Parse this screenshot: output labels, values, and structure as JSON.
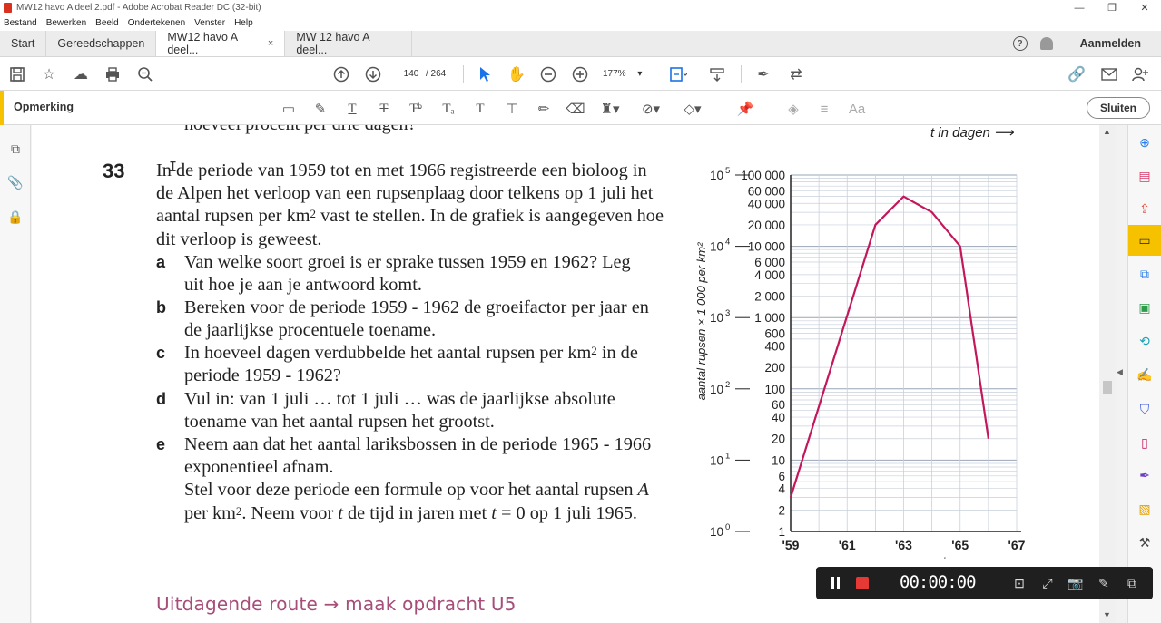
{
  "window": {
    "title": "MW12 havo A deel 2.pdf - Adobe Acrobat Reader DC (32-bit)",
    "minimize": "—",
    "maximize": "❐",
    "close": "✕"
  },
  "menu": [
    "Bestand",
    "Bewerken",
    "Beeld",
    "Ondertekenen",
    "Venster",
    "Help"
  ],
  "tabs": [
    {
      "label": "Start"
    },
    {
      "label": "Gereedschappen"
    },
    {
      "label": "MW12 havo A deel...",
      "close": "×"
    },
    {
      "label": "MW 12 havo A deel..."
    }
  ],
  "header_right": {
    "help": "?",
    "signin": "Aanmelden"
  },
  "toolbar": {
    "page_current": "140",
    "page_total": "/ 264",
    "zoom": "177%"
  },
  "comment_toolbar": {
    "label": "Opmerking",
    "close_label": "Sluiten"
  },
  "document": {
    "prev_line": "hoeveel procent per drie dagen?",
    "t_axis_label": "t in dagen ⟶",
    "question_number": "33",
    "question_text_1": "In de periode van 1959 tot en met 1966 registreerde een bioloog in de Alpen het verloop van een rupsenplaag door telkens op 1 juli het aantal rupsen per km",
    "question_text_sup": "2",
    "question_text_2": " vast te stellen. In de grafiek is aangegeven hoe dit verloop is geweest.",
    "subs": [
      {
        "letter": "a",
        "text": "Van welke soort groei is er sprake tussen 1959 en 1962? Leg uit hoe je aan je antwoord komt."
      },
      {
        "letter": "b",
        "text": "Bereken voor de periode 1959 - 1962 de groeifactor per jaar en de jaarlijkse procentuele toename."
      },
      {
        "letter": "c",
        "text_1": "In hoeveel dagen verdubbelde het aantal rupsen per km",
        "sup": "2",
        "text_2": " in de periode 1959 - 1962?"
      },
      {
        "letter": "d",
        "text": "Vul in: van 1 juli … tot 1 juli … was de jaarlijkse absolute toename van het aantal rupsen het grootst."
      },
      {
        "letter": "e",
        "text": "Neem aan dat het aantal lariksbossen in de periode 1965 - 1966 exponentieel afnam.",
        "text_b1": "Stel voor deze periode een formule op voor het aantal rupsen ",
        "var_A": "A",
        "text_b2": " per km",
        "sup": "2",
        "text_b3": ". Neem voor ",
        "var_t": "t",
        "text_b4": " de tijd in jaren met ",
        "var_t2": "t",
        "text_b5": " = 0 op 1 juli 1965."
      }
    ],
    "route": "Uitdagende route → maak opdracht U5"
  },
  "recorder": {
    "time": "00:00:00"
  },
  "chart_data": {
    "type": "line",
    "ylabel": "aantal rupsen × 1 000 per km²",
    "xlabel": "jaren ⟶",
    "y_scale": "log",
    "ylim": [
      1,
      100000
    ],
    "xlim": [
      1959,
      1967
    ],
    "x_ticks": [
      "'59",
      "'61",
      "'63",
      "'65",
      "'67"
    ],
    "y_tick_labels": [
      "100 000",
      "60 000",
      "40 000",
      "20 000",
      "10 000",
      "6 000",
      "4 000",
      "2 000",
      "1 000",
      "600",
      "400",
      "200",
      "100",
      "60",
      "40",
      "20",
      "10",
      "6",
      "4",
      "2",
      "1"
    ],
    "y_tick_values": [
      100000,
      60000,
      40000,
      20000,
      10000,
      6000,
      4000,
      2000,
      1000,
      600,
      400,
      200,
      100,
      60,
      40,
      20,
      10,
      6,
      4,
      2,
      1
    ],
    "power_labels": [
      {
        "base": "10",
        "exp": "5",
        "value": 100000
      },
      {
        "base": "10",
        "exp": "4",
        "value": 10000
      },
      {
        "base": "10",
        "exp": "3",
        "value": 1000
      },
      {
        "base": "10",
        "exp": "2",
        "value": 100
      },
      {
        "base": "10",
        "exp": "1",
        "value": 10
      },
      {
        "base": "10",
        "exp": "0",
        "value": 1
      }
    ],
    "series": [
      {
        "x": [
          1959,
          1962,
          1963,
          1964,
          1965,
          1966
        ],
        "y": [
          3,
          20000,
          50000,
          30000,
          10000,
          20
        ]
      }
    ],
    "line_color": "#c2185b",
    "grid": true
  }
}
